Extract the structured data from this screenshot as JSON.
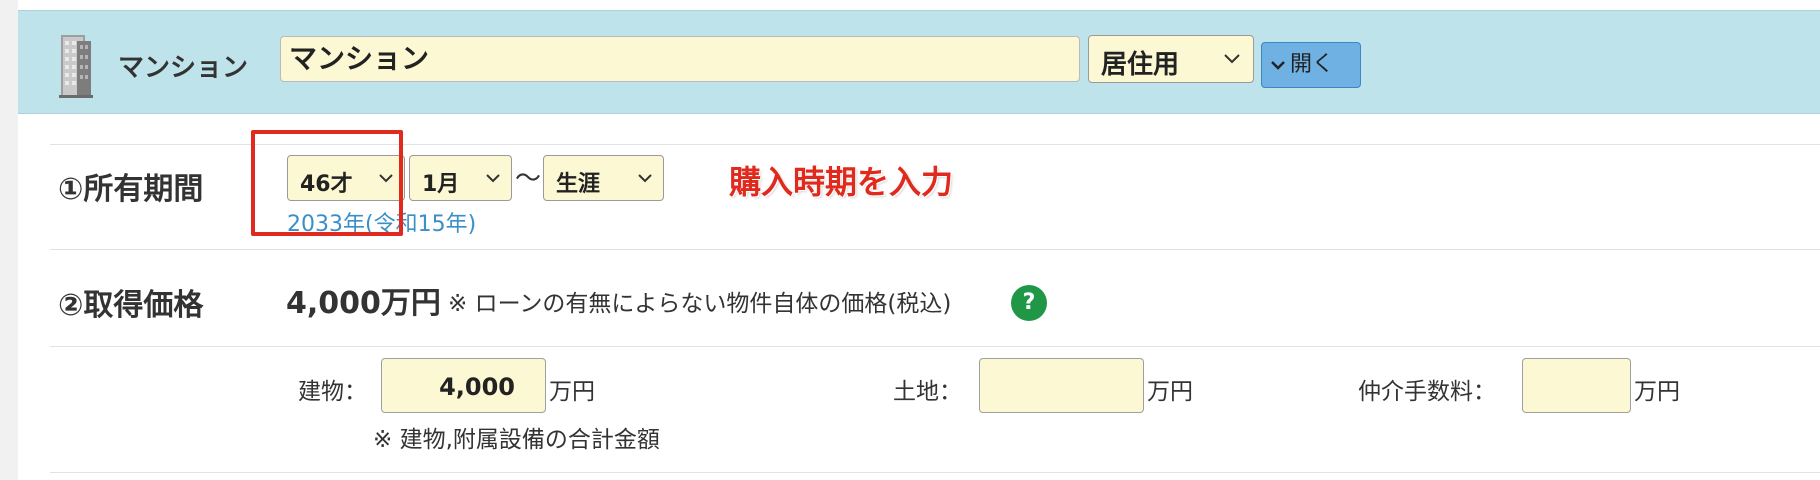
{
  "header": {
    "property_type_label": "マンション",
    "name_value": "マンション",
    "usage_select": "居住用",
    "open_button": "開く"
  },
  "holding_period": {
    "label": "①所有期間",
    "start_age": "46才",
    "start_month": "1月",
    "tilde": "〜",
    "end": "生涯",
    "year_note": "2033年(令和15年)"
  },
  "annotation": {
    "text": "購入時期を入力",
    "color": "#e02a1e"
  },
  "acquisition_price": {
    "label": "②取得価格",
    "value": "4,000万円",
    "note": "※ ローンの有無によらない物件自体の価格(税込)",
    "help_icon": "?"
  },
  "breakdown": {
    "building_label": "建物：",
    "building_value": "4,000",
    "building_unit": "万円",
    "building_note": "※ 建物,附属設備の合計金額",
    "land_label": "土地：",
    "land_value": "",
    "land_unit": "万円",
    "fee_label": "仲介手数料：",
    "fee_value": "",
    "fee_unit": "万円"
  },
  "colors": {
    "header_bg": "#bfe3ea",
    "input_bg": "#fbf8d3",
    "link": "#3a8ec9",
    "help_green": "#1f9747",
    "button_blue": "#6fb1e2"
  }
}
